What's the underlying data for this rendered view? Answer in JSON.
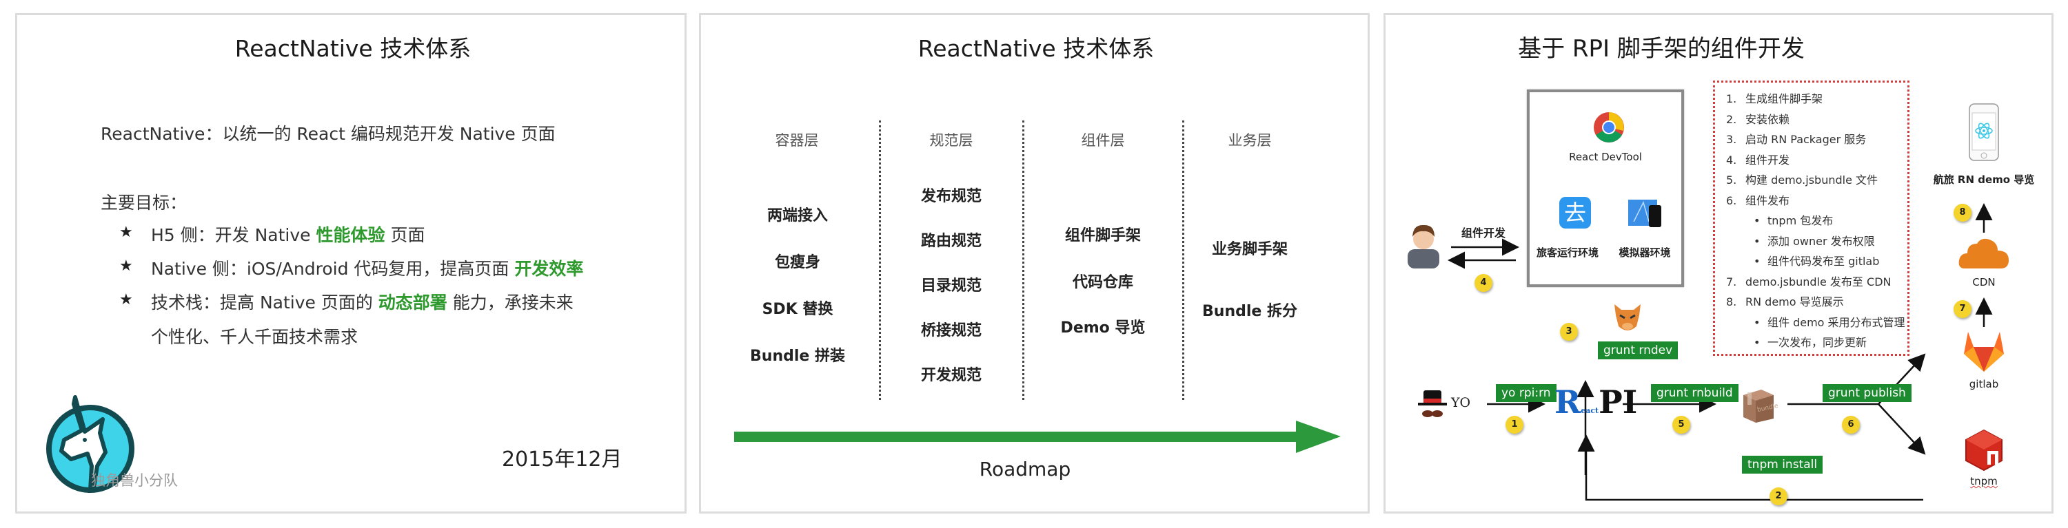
{
  "slides": [
    {
      "title": "ReactNative 技术体系",
      "intro": "ReactNative：以统一的 React 编码规范开发 Native 页面",
      "goals_heading": "主要目标：",
      "goals": [
        {
          "prefix": "H5 侧：开发 Native ",
          "highlight": "性能体验",
          "suffix": " 页面"
        },
        {
          "prefix": "Native 侧：iOS/Android 代码复用，提高页面 ",
          "highlight": "开发效率",
          "suffix": ""
        },
        {
          "prefix": "技术栈：提高 Native 页面的 ",
          "highlight": "动态部署",
          "suffix": " 能力，承接未来",
          "line2": "个性化、千人千面技术需求"
        }
      ],
      "bullet_icon": "★",
      "logo_text": "独角兽小分队",
      "date": "2015年12月",
      "colors": {
        "highlight": "#2e9a2e",
        "logo_fill": "#3fd3ea",
        "logo_outline": "#124a50"
      }
    },
    {
      "title": "ReactNative 技术体系",
      "columns": [
        {
          "header": "容器层",
          "items": [
            "两端接入",
            "包瘦身",
            "SDK 替换",
            "Bundle 拼装"
          ]
        },
        {
          "header": "规范层",
          "items": [
            "发布规范",
            "路由规范",
            "目录规范",
            "桥接规范",
            "开发规范"
          ]
        },
        {
          "header": "组件层",
          "items": [
            "组件脚手架",
            "代码仓库",
            "Demo 导览"
          ]
        },
        {
          "header": "业务层",
          "items": [
            "业务脚手架",
            "Bundle 拆分"
          ]
        }
      ],
      "roadmap_label": "Roadmap",
      "colors": {
        "arrow": "#2c9a3c"
      }
    },
    {
      "title": "基于 RPI 脚手架的组件开发",
      "devtool_box": {
        "react_devtool": "React DevTool",
        "traveler_env": "旅客运行环境",
        "simulator_env": "模拟器环境"
      },
      "developer_label": "组件开发",
      "commands": {
        "yo": "yo rpi:rn",
        "rndev": "grunt rndev",
        "rnbuild": "grunt rnbuild",
        "publish": "grunt publish",
        "install": "tnpm install"
      },
      "yo_label": "YO",
      "rpi_logo": {
        "r": "R",
        "eact": "eact",
        "pi": "PI"
      },
      "bundle_label": "bundle",
      "badges": [
        "1",
        "2",
        "3",
        "4",
        "5",
        "6",
        "7",
        "8"
      ],
      "steps": [
        {
          "num": "1.",
          "text": "生成组件脚手架"
        },
        {
          "num": "2.",
          "text": "安装依赖"
        },
        {
          "num": "3.",
          "text": "启动 RN Packager 服务"
        },
        {
          "num": "4.",
          "text": "组件开发"
        },
        {
          "num": "5.",
          "text": "构建 demo.jsbundle 文件"
        },
        {
          "num": "6.",
          "text": "组件发布"
        },
        {
          "num": "•",
          "text": "tnpm 包发布",
          "sub": true
        },
        {
          "num": "•",
          "text": "添加 owner 发布权限",
          "sub": true
        },
        {
          "num": "•",
          "text": "组件代码发布至 gitlab",
          "sub": true
        },
        {
          "num": "7.",
          "text": "demo.jsbundle 发布至 CDN"
        },
        {
          "num": "8.",
          "text": "RN demo 导览展示"
        },
        {
          "num": "•",
          "text": "组件 demo 采用分布式管理",
          "sub": true
        },
        {
          "num": "•",
          "text": "一次发布，同步更新",
          "sub": true
        }
      ],
      "targets": {
        "phone": "航旅 RN demo 导览",
        "cdn": "CDN",
        "gitlab": "gitlab",
        "tnpm": "tnpm"
      },
      "colors": {
        "command_bg": "#1c8a2e",
        "badge": "#f4d42c",
        "list_border": "#d43d3d",
        "cdn": "#e8801e",
        "tnpm": "#d42a1e",
        "gitlab": "#e24329"
      }
    }
  ]
}
